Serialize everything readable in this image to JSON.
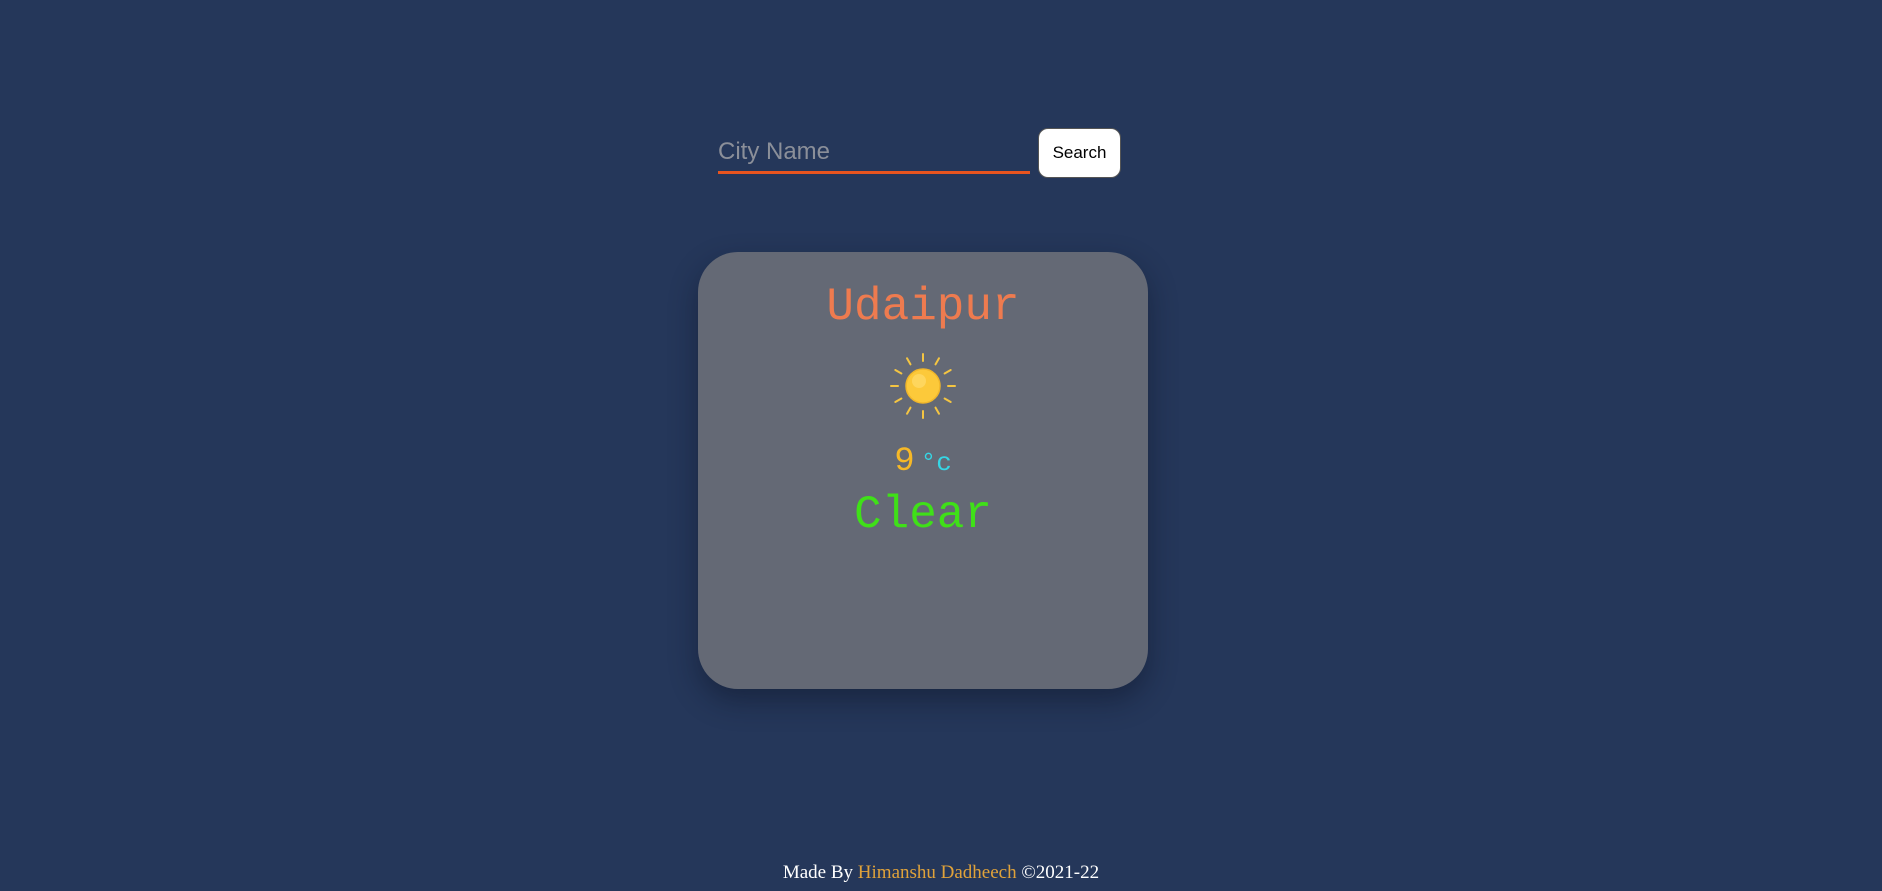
{
  "search": {
    "placeholder": "City Name",
    "value": "",
    "button_label": "Search"
  },
  "weather": {
    "city": "Udaipur",
    "icon": "sun-icon",
    "temperature": "9",
    "unit": "°c",
    "condition": "Clear"
  },
  "footer": {
    "prefix": "Made By",
    "author": "Himanshu Dadheech",
    "copyright": "©2021-22"
  },
  "colors": {
    "background": "#25375a",
    "card": "#646975",
    "input_underline": "#e8541f",
    "city": "#ee7b4f",
    "temperature": "#f6b827",
    "unit": "#36d6e5",
    "condition": "#3fe018",
    "author": "#e0a23a"
  }
}
